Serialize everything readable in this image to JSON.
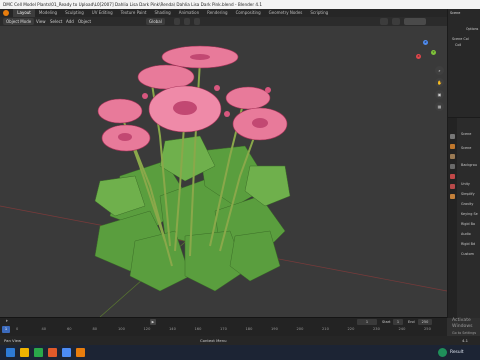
{
  "window": {
    "title": "DMC Cell Model Plants\\01_Ready to Upload\\L0[2007] Dahlia Lisa Dark Pink\\Renda\\ Dahlia Lisa Dark Pink.blend - Blender 4.1"
  },
  "workspaces": [
    "Layout",
    "Modeling",
    "Sculpting",
    "UV Editing",
    "Texture Paint",
    "Shading",
    "Animation",
    "Rendering",
    "Compositing",
    "Geometry Nodes",
    "Scripting"
  ],
  "active_workspace": "Layout",
  "header": {
    "mode": "Object Mode",
    "view": "View",
    "select": "Select",
    "add": "Add",
    "object": "Object",
    "orientation": "Global",
    "scene_label": "Scene",
    "options_label": "Options"
  },
  "outliner": {
    "title": "Scene",
    "items": [
      "Scene Col",
      "Coll"
    ]
  },
  "properties": {
    "tabs": [
      "Scene"
    ],
    "rows": [
      "Scene",
      "Backgrou",
      "Unity",
      "Simplify",
      "Gravity",
      "Keying Se",
      "Rigid Bo",
      "Audio",
      "Rigid Bd",
      "Custom"
    ]
  },
  "gizmo": {
    "x": "X",
    "y": "Y",
    "z": "Z"
  },
  "timeline": {
    "ticks": [
      "0",
      "40",
      "60",
      "80",
      "100",
      "120",
      "140",
      "160",
      "170",
      "180",
      "190",
      "200",
      "210",
      "220",
      "230",
      "240",
      "250"
    ],
    "start_label": "Start",
    "start_value": "1",
    "end_label": "End",
    "end_value": "250",
    "current_frame": "1"
  },
  "status": {
    "left": "Pan View",
    "center": "Context Menu",
    "right": "4.1"
  },
  "watermark": {
    "line1": "Activate Windows",
    "line2": "Go to Settings to activate Windows."
  },
  "taskbar": {
    "result_label": "Result",
    "icon_colors": [
      "#2e7bd6",
      "#f0b400",
      "#2aa84a",
      "#e05a2a",
      "#4c8cf6",
      "#e87d0d"
    ]
  },
  "colors": {
    "petal": "#e87a9a",
    "leaf": "#5a9e3e",
    "accent": "#e87d0d"
  }
}
